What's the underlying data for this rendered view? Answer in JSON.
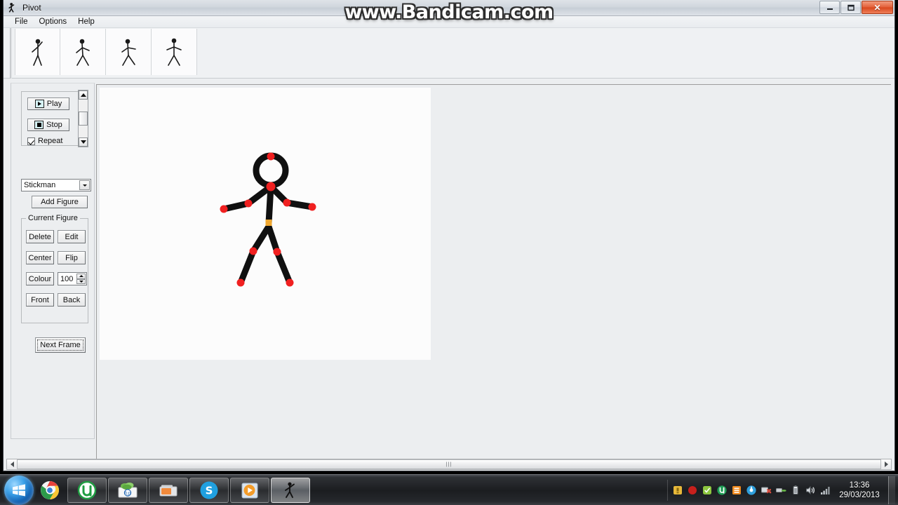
{
  "window": {
    "title": "Pivot",
    "icon": "stickman-icon",
    "controls": {
      "minimize": "—",
      "maximize": "❐",
      "close": "✕"
    }
  },
  "menu": {
    "items": [
      {
        "label": "File",
        "name": "menu-file"
      },
      {
        "label": "Options",
        "name": "menu-options"
      },
      {
        "label": "Help",
        "name": "menu-help"
      }
    ]
  },
  "frames": {
    "count": 4,
    "thumbnails": [
      {
        "label": "Frame 1"
      },
      {
        "label": "Frame 2"
      },
      {
        "label": "Frame 3"
      },
      {
        "label": "Frame 4"
      }
    ]
  },
  "controls": {
    "play_label": "Play",
    "stop_label": "Stop",
    "repeat_label": "Repeat",
    "repeat_checked": true,
    "figure_type": "Stickman",
    "add_figure_label": "Add Figure",
    "current_figure_legend": "Current Figure",
    "delete_label": "Delete",
    "edit_label": "Edit",
    "center_label": "Center",
    "flip_label": "Flip",
    "colour_label": "Colour",
    "scale_value": "100",
    "front_label": "Front",
    "back_label": "Back",
    "next_frame_label": "Next Frame"
  },
  "figure": {
    "limb_color": "#101010",
    "joint_color": "#f02020",
    "hip_color": "#f0a830",
    "canvas_bg": "#fcfcfc"
  },
  "watermark": {
    "text": "www.Bandicam.com"
  },
  "taskbar": {
    "start_icon": "windows-start-orb",
    "quicklaunch": [
      {
        "name": "chrome-icon",
        "label": "Google Chrome"
      }
    ],
    "tasks": [
      {
        "name": "task-utorrent",
        "label": "uTorrent",
        "active": false
      },
      {
        "name": "task-hp",
        "label": "HP",
        "active": false
      },
      {
        "name": "task-media",
        "label": "Media",
        "active": false
      },
      {
        "name": "task-skype",
        "label": "Skype",
        "active": false
      },
      {
        "name": "task-player",
        "label": "Media Player",
        "active": false
      },
      {
        "name": "task-pivot",
        "label": "Pivot",
        "active": true
      }
    ],
    "tray": [
      {
        "name": "tray-icon-1",
        "color": "#e8b93a"
      },
      {
        "name": "tray-icon-2",
        "color": "#c8201c"
      },
      {
        "name": "tray-icon-3",
        "color": "#8dc63f"
      },
      {
        "name": "tray-icon-4",
        "color": "#1f9d55"
      },
      {
        "name": "tray-icon-5",
        "color": "#f08a1e"
      },
      {
        "name": "tray-icon-6",
        "color": "#2f9fdc"
      },
      {
        "name": "tray-icon-7",
        "color": "#d24b3e"
      },
      {
        "name": "tray-icon-8",
        "color": "#6cbf4a"
      }
    ],
    "clock": {
      "time": "13:36",
      "date": "29/03/2013"
    }
  }
}
